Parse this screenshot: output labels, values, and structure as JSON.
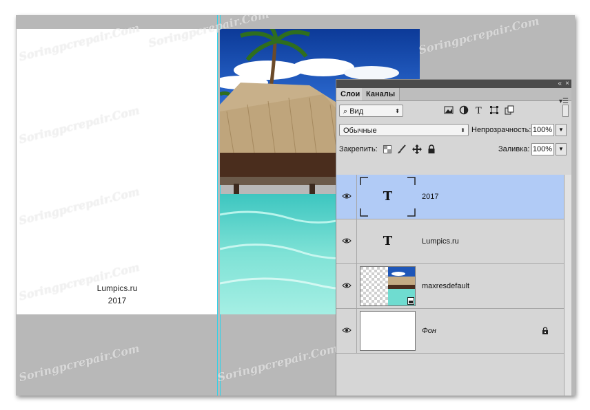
{
  "document": {
    "text_line1": "Lumpics.ru",
    "text_line2": "2017"
  },
  "watermark": "Soringpcrepair.Com",
  "panel": {
    "tabs": [
      "Слои",
      "Каналы"
    ],
    "active_tab": "Слои",
    "filter_select": "Вид",
    "blend_mode": "Обычные",
    "opacity_label": "Непрозрачность:",
    "opacity_value": "100%",
    "lock_label": "Закрепить:",
    "fill_label": "Заливка:",
    "fill_value": "100%",
    "layers": [
      {
        "name": "2017",
        "thumb": "T",
        "selected": true
      },
      {
        "name": "Lumpics.ru",
        "thumb": "T",
        "selected": false
      },
      {
        "name": "maxresdefault",
        "thumb": "image",
        "selected": false
      },
      {
        "name": "Фон",
        "thumb": "white",
        "selected": false,
        "locked": true
      }
    ]
  },
  "colors": {
    "selected_layer": "#b1cbf6",
    "guide": "#2fd3ea",
    "canvas_bg": "#b8b8b8"
  },
  "icons": [
    "search-icon",
    "image-filter-icon",
    "adjustment-filter-icon",
    "type-filter-icon",
    "shape-filter-icon",
    "smart-object-filter-icon",
    "lock-transparency-icon",
    "lock-brush-icon",
    "lock-move-icon",
    "lock-all-icon",
    "eye-icon",
    "lock-icon",
    "collapse-icon",
    "close-icon",
    "panel-menu-icon"
  ]
}
